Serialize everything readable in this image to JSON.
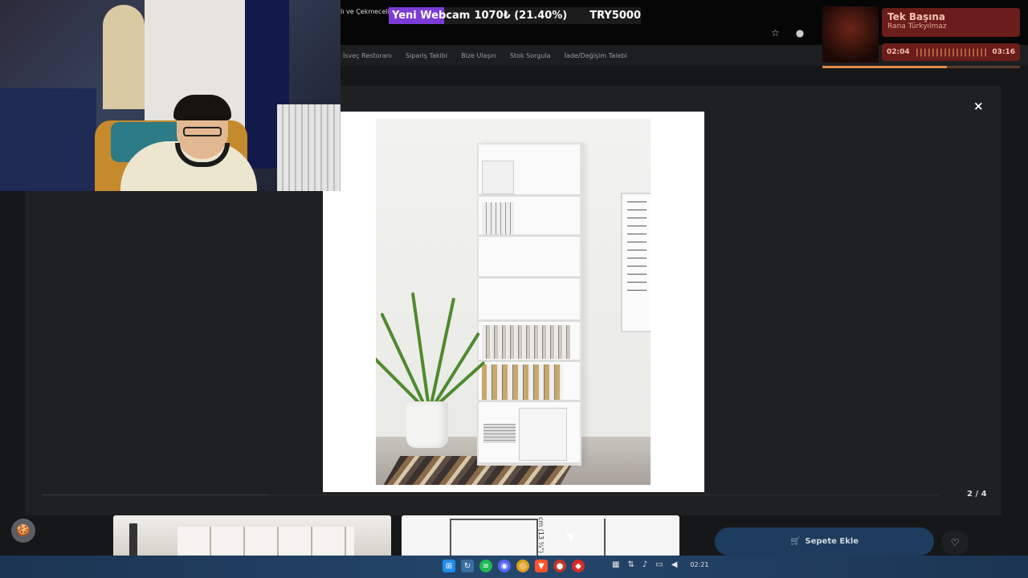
{
  "browser": {
    "crumb": "lı ve Çekmeceli"
  },
  "goal": {
    "label": "Yeni Webcam",
    "amount": "1070₺ (21.40%)",
    "target": "TRY5000",
    "progress_fraction": 0.214,
    "fill_color": "#7b3cd6"
  },
  "site_nav": {
    "items": [
      "İsveç Restoranı",
      "Sipariş Takibi",
      "Bize Ulaşın",
      "Stok Sorgula",
      "İade/Değişim Talebi"
    ]
  },
  "music": {
    "title": "Tek Başına",
    "artist": "Rana Türkyılmaz",
    "elapsed": "02:04",
    "total": "03:16",
    "wave": "||||||||||||||||||",
    "progress_fraction": 0.632
  },
  "modal": {
    "close_glyph": "×",
    "counter": "2 / 4",
    "slide_fraction": 0.25
  },
  "product_image": {
    "subject": "white-bookcase-photo"
  },
  "thumbnails": {
    "dimension_label": "cm (13 ¾\")"
  },
  "actions": {
    "add_to_cart_label": "Sepete Ekle",
    "cart_glyph": "🛒",
    "favorite_glyph": "♡",
    "cookie_glyph": "🍪"
  },
  "taskbar": {
    "clock": "02:21",
    "icons": [
      "windows-start-icon",
      "sync-icon",
      "spotify-icon",
      "discord-icon",
      "chrome-icon",
      "brave-icon",
      "steam-icon",
      "game-icon"
    ]
  },
  "colors": {
    "brand_button": "#1d3c5e",
    "music_panel": "#6a1d1a"
  }
}
